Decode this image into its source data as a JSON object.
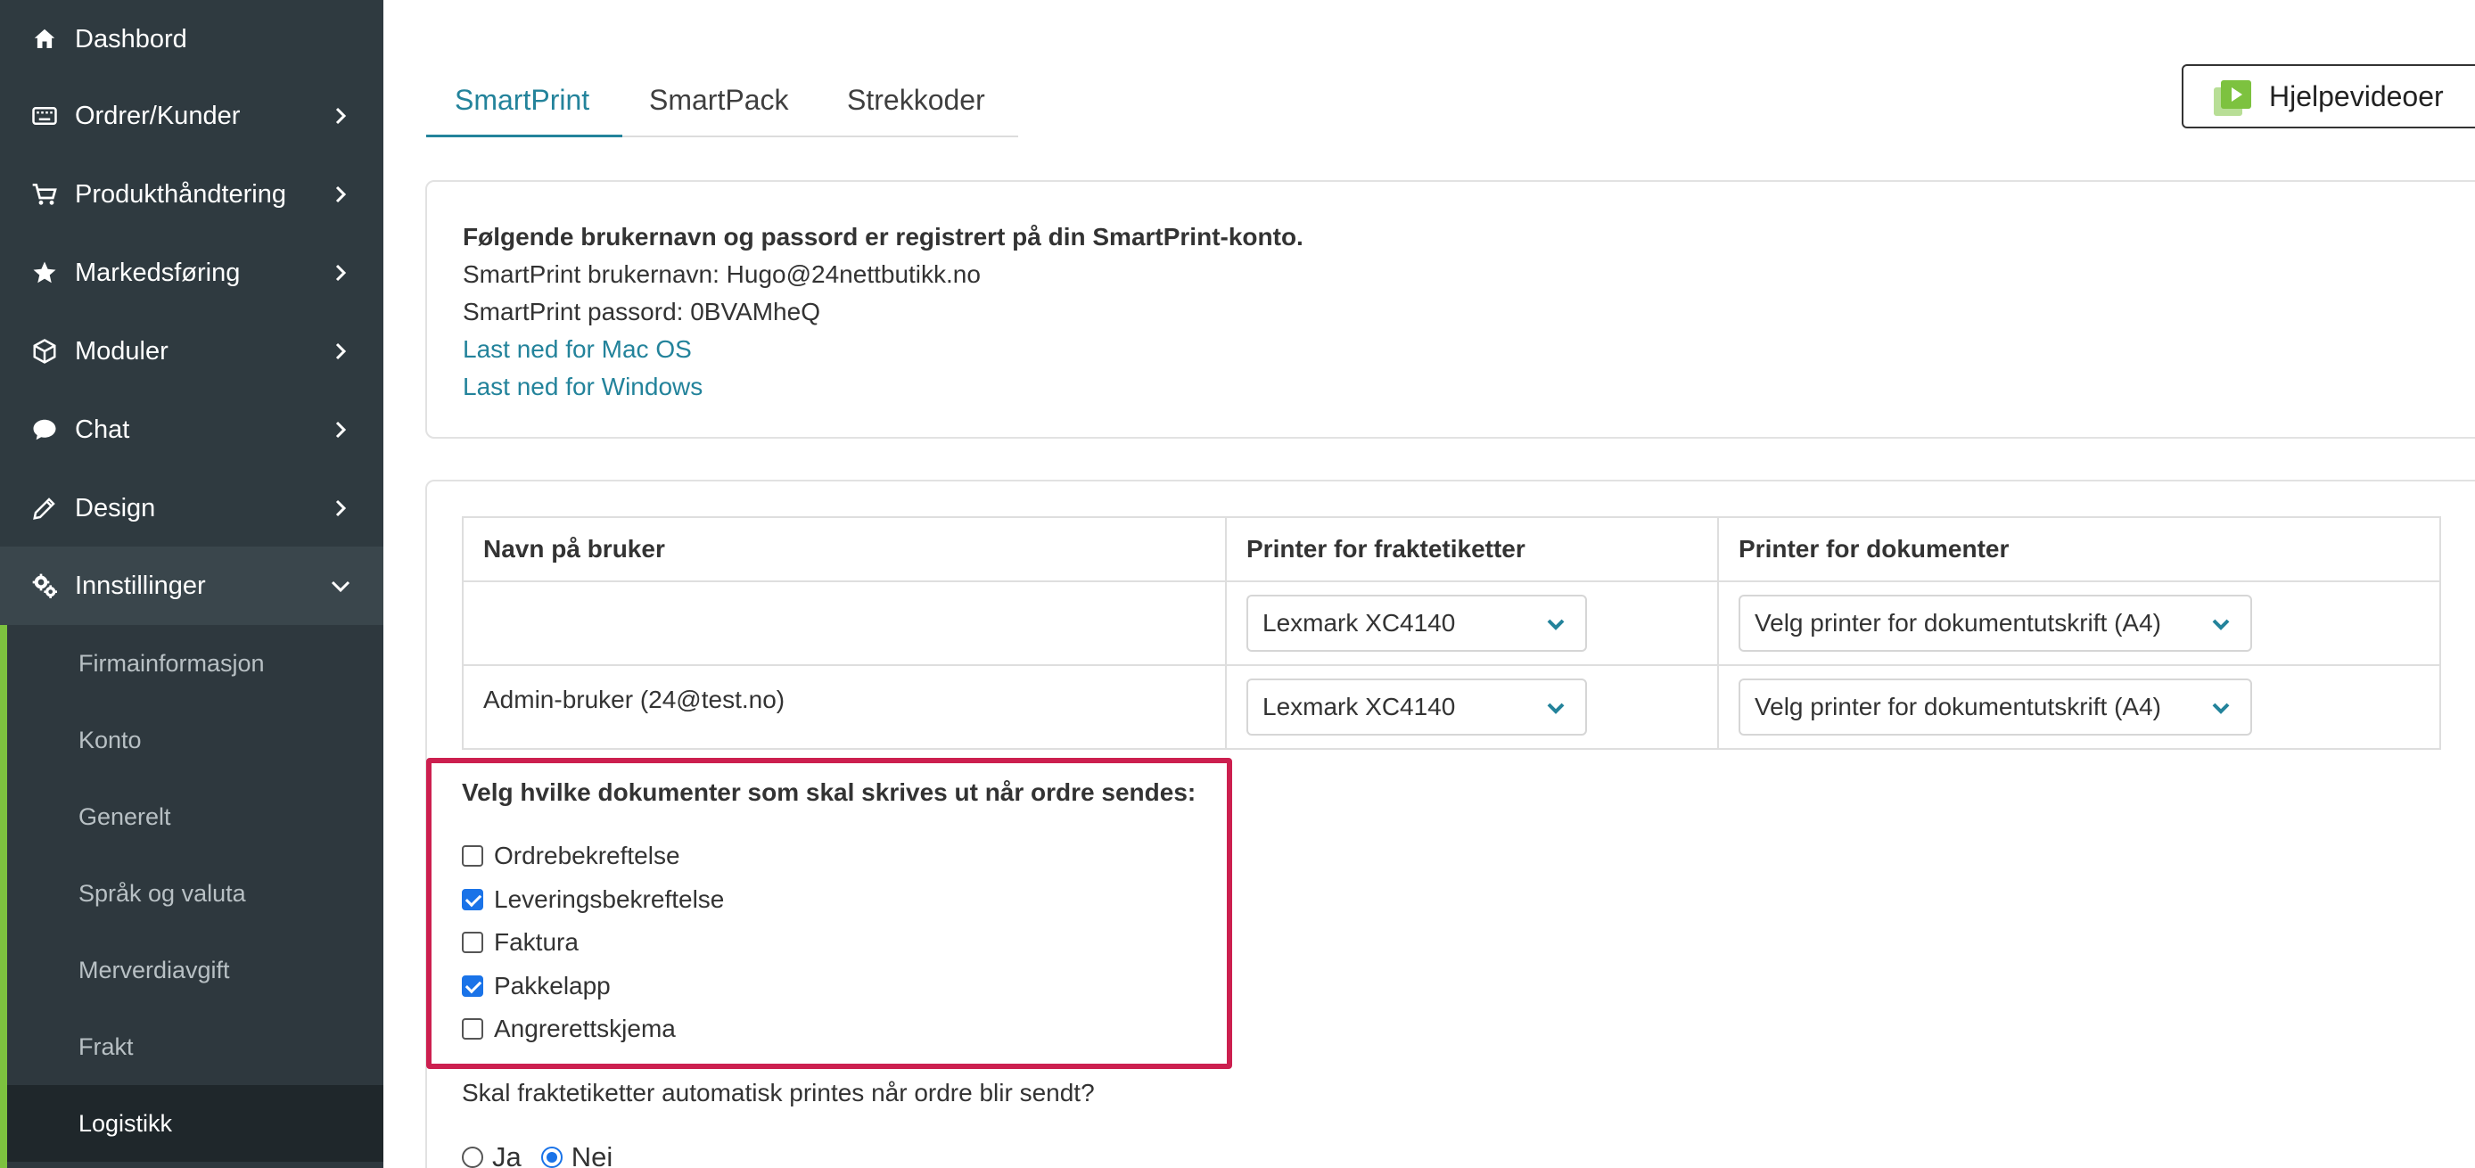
{
  "sidebar": {
    "items": [
      {
        "label": "Dashbord",
        "icon": "home-icon"
      },
      {
        "label": "Ordrer/Kunder",
        "icon": "keyboard-icon"
      },
      {
        "label": "Produkthåndtering",
        "icon": "cart-icon"
      },
      {
        "label": "Markedsføring",
        "icon": "star-icon"
      },
      {
        "label": "Moduler",
        "icon": "cube-icon"
      },
      {
        "label": "Chat",
        "icon": "chat-bubble-icon"
      },
      {
        "label": "Design",
        "icon": "pencil-icon"
      },
      {
        "label": "Innstillinger",
        "icon": "gears-icon"
      }
    ],
    "subitems": [
      {
        "label": "Firmainformasjon"
      },
      {
        "label": "Konto"
      },
      {
        "label": "Generelt"
      },
      {
        "label": "Språk og valuta"
      },
      {
        "label": "Merverdiavgift"
      },
      {
        "label": "Frakt"
      },
      {
        "label": "Logistikk"
      }
    ],
    "accent_color": "#7dc23f"
  },
  "tabs": [
    {
      "label": "SmartPrint",
      "active": true
    },
    {
      "label": "SmartPack",
      "active": false
    },
    {
      "label": "Strekkoder",
      "active": false
    }
  ],
  "help_button": {
    "label": "Hjelpevideoer",
    "icon": "video-play-icon"
  },
  "info": {
    "heading": "Følgende brukernavn og passord er registrert på din SmartPrint-konto.",
    "username_line": "SmartPrint brukernavn: Hugo@24nettbutikk.no",
    "password_line": "SmartPrint passord: 0BVAMheQ",
    "mac_link": "Last ned for Mac OS",
    "windows_link": "Last ned for Windows"
  },
  "table": {
    "headers": [
      "Navn på bruker",
      "Printer for fraktetiketter",
      "Printer for dokumenter"
    ],
    "rows": [
      {
        "user": "",
        "label_printer": "Lexmark XC4140",
        "doc_printer": "Velg printer for dokumentutskrift (A4)"
      },
      {
        "user": "Admin-bruker (24@test.no)",
        "label_printer": "Lexmark XC4140",
        "doc_printer": "Velg printer for dokumentutskrift (A4)"
      }
    ]
  },
  "documents": {
    "title": "Velg hvilke dokumenter som skal skrives ut når ordre sendes:",
    "options": [
      {
        "label": "Ordrebekreftelse",
        "checked": false
      },
      {
        "label": "Leveringsbekreftelse",
        "checked": true
      },
      {
        "label": "Faktura",
        "checked": false
      },
      {
        "label": "Pakkelapp",
        "checked": true
      },
      {
        "label": "Angrerettskjema",
        "checked": false
      }
    ],
    "highlight_color": "#cc1f4f"
  },
  "auto_print": {
    "question": "Skal fraktetiketter automatisk printes når ordre blir sendt?",
    "yes_label": "Ja",
    "no_label": "Nei",
    "selected": "Nei"
  },
  "colors": {
    "link": "#23839b",
    "sidebar_bg": "#2f3a40"
  }
}
